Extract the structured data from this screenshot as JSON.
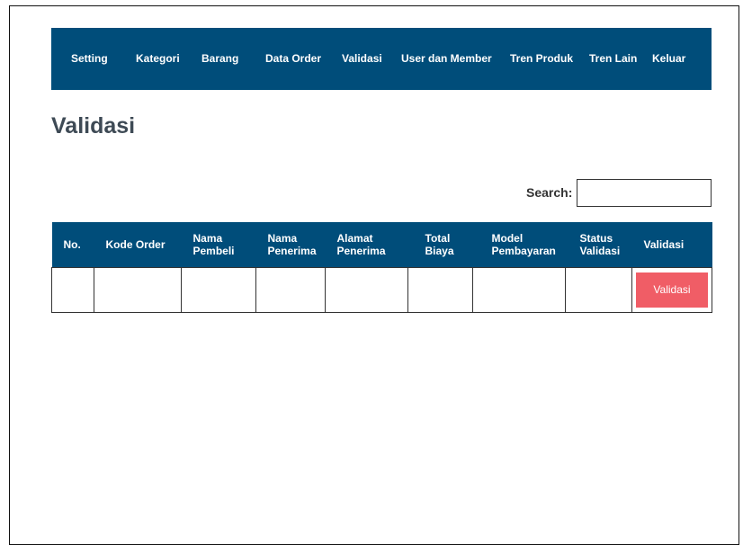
{
  "nav": {
    "items": [
      {
        "label": "Setting"
      },
      {
        "label": "Kategori"
      },
      {
        "label": "Barang"
      },
      {
        "label": "Data Order"
      },
      {
        "label": "Validasi"
      },
      {
        "label": "User dan Member"
      },
      {
        "label": "Tren Produk"
      },
      {
        "label": "Tren Lain"
      },
      {
        "label": "Keluar"
      }
    ]
  },
  "page": {
    "title": "Validasi"
  },
  "search": {
    "label": "Search:",
    "value": ""
  },
  "table": {
    "columns": [
      {
        "label": "No."
      },
      {
        "label": "Kode Order"
      },
      {
        "label": "Nama\nPembeli"
      },
      {
        "label": "Nama\nPenerima"
      },
      {
        "label": "Alamat\nPenerima"
      },
      {
        "label": "Total\nBiaya"
      },
      {
        "label": "Model\nPembayaran"
      },
      {
        "label": "Status\nValidasi"
      },
      {
        "label": "Validasi"
      }
    ],
    "row_action_label": "Validasi"
  },
  "colors": {
    "nav_background": "#004d7a",
    "header_background": "#004d7a",
    "action_button": "#f05d66",
    "title_text": "#3e4a55"
  }
}
